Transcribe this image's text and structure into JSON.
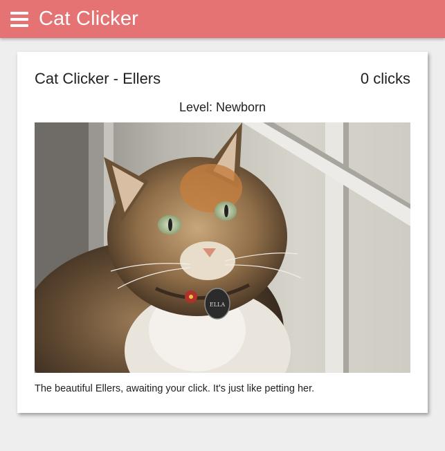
{
  "app_bar": {
    "title": "Cat Clicker",
    "menu_icon": "hamburger-menu-icon",
    "color": "#e57373"
  },
  "cat_card": {
    "title": "Cat Clicker - Ellers",
    "clicks": "0 clicks",
    "level": "Level: Newborn",
    "image_subject": "tabby calico cat by a window",
    "tag_text": "ELLA",
    "caption": "The beautiful Ellers, awaiting your click. It's just like petting her."
  }
}
